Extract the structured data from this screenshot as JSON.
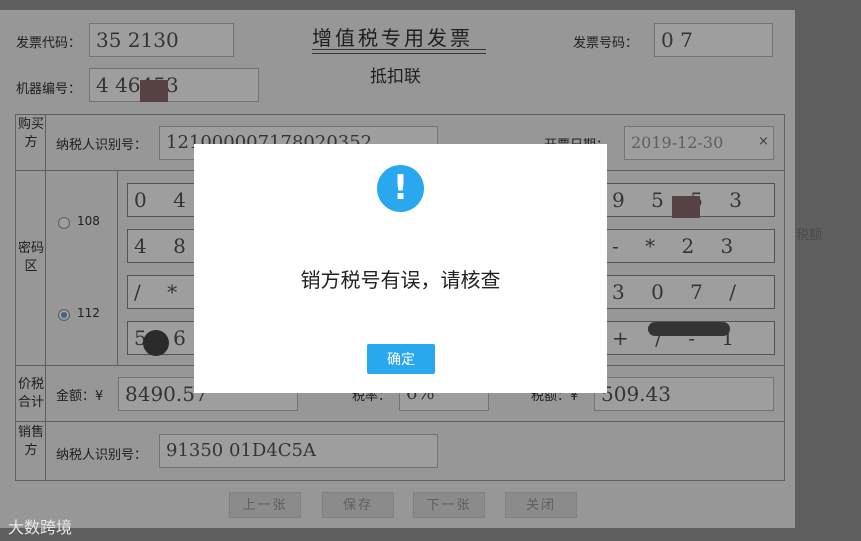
{
  "invoice": {
    "title": "增值税专用发票",
    "subtitle": "抵扣联",
    "code_label": "发票代码：",
    "code_value": "35        2130",
    "number_label": "发票号码：",
    "number_value": "0            7",
    "machine_label": "机器编号：",
    "machine_value": "4         46453",
    "buyer_section": "购买方",
    "buyer_tax_id_label": "纳税人识别号：",
    "buyer_tax_id_value": "121000007178020352",
    "date_label": "开票日期：",
    "date_value": "2019-12-30",
    "date_clear": "×",
    "cipher_section": "密码区",
    "radio_108": "108",
    "radio_112": "112",
    "cipher_rows": [
      {
        "left": "0  4",
        "right": "9 5      5 3"
      },
      {
        "left": "4  8",
        "right": "-       * 2 3"
      },
      {
        "left": "/    *",
        "right": "3        0 7 /"
      },
      {
        "left": "5  6",
        "right": "+ /         - 1"
      }
    ],
    "price_tax_section": "价税合计",
    "amount_label": "金额：¥",
    "amount_value": "8490.57",
    "rate_label": "税率：",
    "rate_value": "6%",
    "tax_label": "税额：¥",
    "tax_value": "509.43",
    "seller_section": "销售方",
    "seller_tax_id_label": "纳税人识别号：",
    "seller_tax_id_value": "91350         01D4C5A"
  },
  "buttons": {
    "prev": "上一张",
    "save": "保存",
    "next": "下一张",
    "close": "关闭"
  },
  "background": {
    "side_text": "税额"
  },
  "dialog": {
    "icon": "!",
    "message": "销方税号有误，请核查",
    "ok": "确定"
  },
  "watermark": "大数跨境"
}
